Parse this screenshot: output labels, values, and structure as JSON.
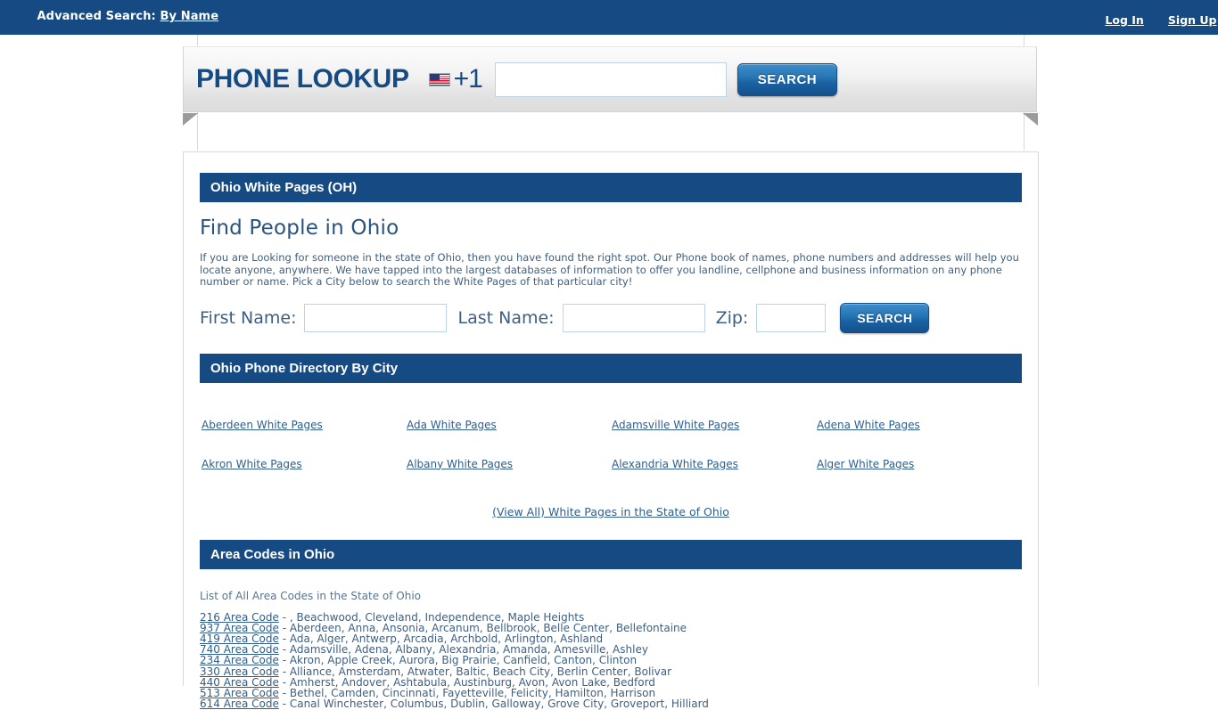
{
  "topbar": {
    "advanced_search_label": "Advanced Search:",
    "by_name_link": "By Name",
    "login_link": "Log In",
    "signup_link": "Sign Up"
  },
  "lookup": {
    "brand": "PHONE LOOKUP",
    "country_code": "+1",
    "flag_icon": "us-flag-icon",
    "phone_value": "",
    "phone_placeholder": "",
    "search_label": "SEARCH"
  },
  "main": {
    "page_header": "Ohio White Pages (OH)",
    "title": "Find People in Ohio",
    "intro": "If you are Looking for someone in the state of Ohio, then you have found the right spot. Our Phone book of names, phone numbers and addresses will help you locate anyone, anywhere. We have tapped into the largest databases of information to offer you landline, cellphone and business information on any phone number or name. Pick a City below to search the White Pages of that particular city!",
    "form": {
      "first_name_label": "First Name:",
      "first_name_value": "",
      "last_name_label": "Last Name:",
      "last_name_value": "",
      "zip_label": "Zip:",
      "zip_value": "",
      "search_label": "SEARCH"
    },
    "directory_header": "Ohio Phone Directory By City",
    "cities": [
      "Aberdeen White Pages",
      "Ada White Pages",
      "Adamsville White Pages",
      "Adena White Pages",
      "Akron White Pages",
      "Albany White Pages",
      "Alexandria White Pages",
      "Alger White Pages"
    ],
    "view_all_link": "(View All) White Pages in the State of Ohio",
    "area_codes_header": "Area Codes in Ohio",
    "area_codes_caption": "List of All Area Codes in the State of Ohio",
    "area_codes": [
      {
        "code": "216 Area Code",
        "cities": "- , Beachwood, Cleveland, Independence, Maple Heights"
      },
      {
        "code": "937 Area Code",
        "cities": "- Aberdeen, Anna, Ansonia, Arcanum, Bellbrook, Belle Center, Bellefontaine"
      },
      {
        "code": "419 Area Code",
        "cities": "- Ada, Alger, Antwerp, Arcadia, Archbold, Arlington, Ashland"
      },
      {
        "code": "740 Area Code",
        "cities": "- Adamsville, Adena, Albany, Alexandria, Amanda, Amesville, Ashley"
      },
      {
        "code": "234 Area Code",
        "cities": "- Akron, Apple Creek, Aurora, Big Prairie, Canfield, Canton, Clinton"
      },
      {
        "code": "330 Area Code",
        "cities": "- Alliance, Amsterdam, Atwater, Baltic, Beach City, Berlin Center, Bolivar"
      },
      {
        "code": "440 Area Code",
        "cities": "- Amherst, Andover, Ashtabula, Austinburg, Avon, Avon Lake, Bedford"
      },
      {
        "code": "513 Area Code",
        "cities": "- Bethel, Camden, Cincinnati, Fayetteville, Felicity, Hamilton, Harrison"
      },
      {
        "code": "614 Area Code",
        "cities": "- Canal Winchester, Columbus, Dublin, Galloway, Grove City, Groveport, Hilliard"
      }
    ]
  },
  "colors": {
    "brand_blue": "#154a82",
    "link_blue": "#2f5d8c",
    "text_blue": "#3f5f80"
  }
}
